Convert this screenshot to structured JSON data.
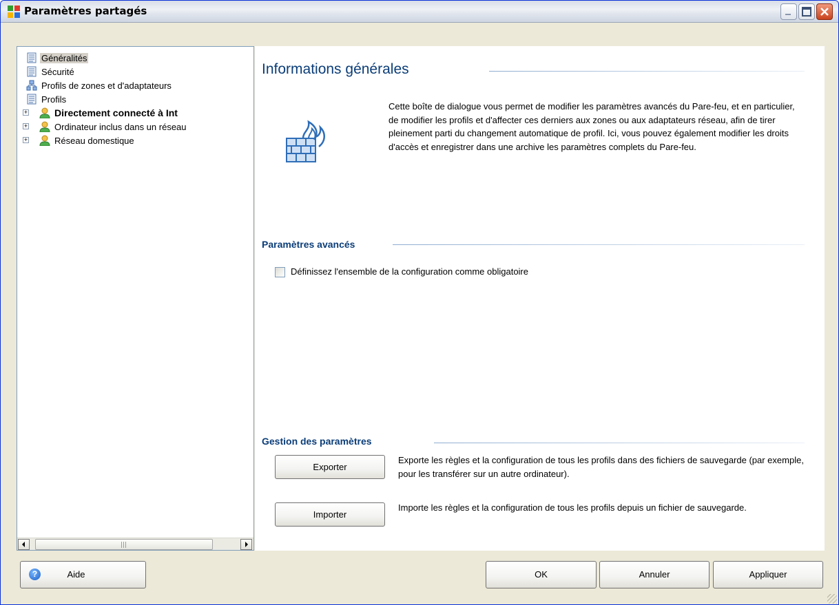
{
  "window": {
    "title": "Paramètres partagés"
  },
  "tree": {
    "items": [
      {
        "label": "Généralités",
        "icon": "document-list-icon"
      },
      {
        "label": "Sécurité",
        "icon": "document-list-icon"
      },
      {
        "label": "Profils de zones et d'adaptateurs",
        "icon": "network-icon"
      },
      {
        "label": "Profils",
        "icon": "document-list-icon"
      },
      {
        "label": "Directement connecté à Int",
        "icon": "user-icon"
      },
      {
        "label": "Ordinateur inclus dans un réseau",
        "icon": "user-icon"
      },
      {
        "label": "Réseau domestique",
        "icon": "user-icon"
      }
    ]
  },
  "content": {
    "heading": "Informations générales",
    "description": "Cette boîte de dialogue vous permet de modifier les paramètres avancés du Pare-feu, et en particulier, de modifier les profils et d'affecter ces derniers aux zones ou aux adaptateurs réseau, afin de tirer pleinement parti du changement automatique de profil. Ici, vous pouvez également modifier les droits d'accès et enregistrer dans une archive les paramètres complets du Pare-feu.",
    "advanced": {
      "title": "Paramètres avancés",
      "checkbox_label": "Définissez l'ensemble de la configuration comme obligatoire",
      "checked": false
    },
    "management": {
      "title": "Gestion des paramètres",
      "export_label": "Exporter",
      "export_desc": "Exporte les règles et la configuration de tous les profils dans des fichiers de sauvegarde (par exemple, pour les transférer sur un autre ordinateur).",
      "import_label": "Importer",
      "import_desc": "Importe les règles et la configuration de tous les profils depuis un fichier de sauvegarde."
    }
  },
  "footer": {
    "help_label": "Aide",
    "ok_label": "OK",
    "cancel_label": "Annuler",
    "apply_label": "Appliquer"
  },
  "colors": {
    "section_title": "#0b3d78",
    "window_border": "#0831d9",
    "dialog_bg": "#ece9d8"
  }
}
